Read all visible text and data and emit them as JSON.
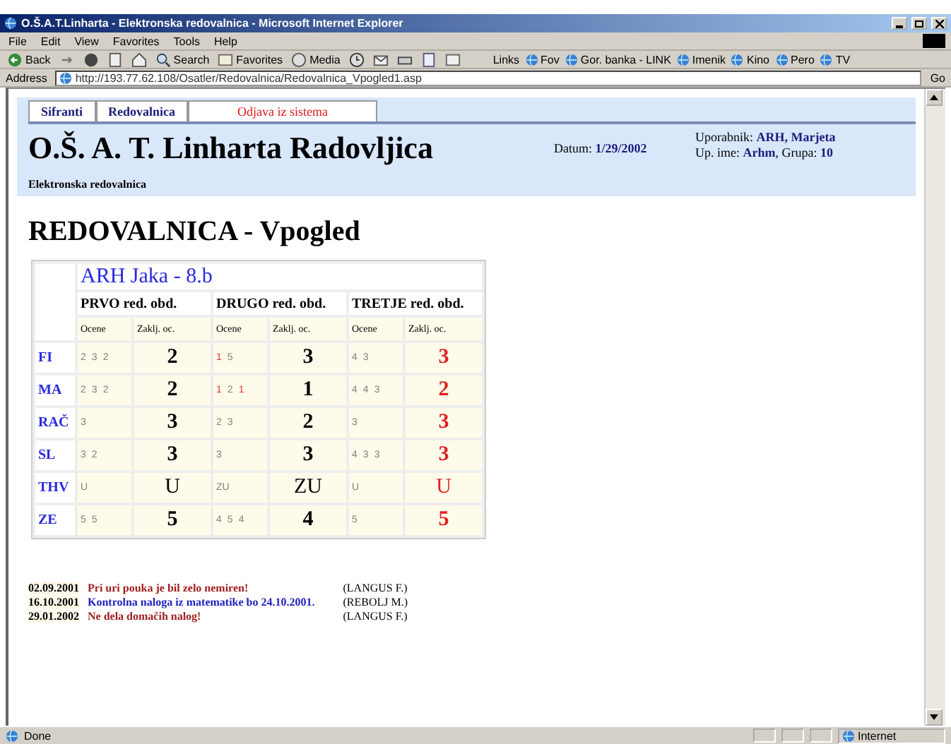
{
  "window": {
    "title": "O.Š.A.T.Linharta - Elektronska redovalnica - Microsoft Internet Explorer"
  },
  "menu": [
    "File",
    "Edit",
    "View",
    "Favorites",
    "Tools",
    "Help"
  ],
  "toolbar": [
    {
      "kind": "back",
      "label": "Back"
    },
    {
      "kind": "forward"
    },
    {
      "kind": "stop"
    },
    {
      "kind": "refresh"
    },
    {
      "kind": "home"
    },
    {
      "kind": "search",
      "label": "Search"
    },
    {
      "kind": "favorites",
      "label": "Favorites"
    },
    {
      "kind": "media",
      "label": "Media"
    },
    {
      "kind": "history"
    },
    {
      "kind": "mail"
    },
    {
      "kind": "print"
    },
    {
      "kind": "edit"
    },
    {
      "kind": "discuss"
    }
  ],
  "links": {
    "label": "Links",
    "items": [
      "Fov",
      "Gor. banka - LINK",
      "Imenik",
      "Kino",
      "Pero",
      "TV"
    ]
  },
  "address": {
    "label": "Address",
    "value": "http://193.77.62.108/Osatler/Redovalnica/Redovalnica_Vpogled1.asp",
    "go": "Go"
  },
  "nav_tabs": [
    {
      "label": "Sifranti",
      "kind": "normal"
    },
    {
      "label": "Redovalnica",
      "kind": "normal"
    },
    {
      "label": "Odjava iz sistema",
      "kind": "logout"
    }
  ],
  "header": {
    "school": "O.Š. A. T. Linharta Radovljica",
    "date": "Datum: **1/29/2002**",
    "user": "Uporabnik: **ARH, Marjeta**",
    "login": "Up. ime: **Arhm**, Grupa: **10**",
    "subtitle": "Elektronska redovalnica"
  },
  "page_title": "REDOVALNICA - Vpogled",
  "grades": {
    "student": "ARH Jaka - 8.b",
    "periods": [
      "PRVO red. obd.",
      "DRUGO red. obd.",
      "TRETJE red. obd."
    ],
    "subheads": [
      "Ocene",
      "Zaklj. oc.",
      "Ocene",
      "Zaklj. oc.",
      "Ocene",
      "Zaklj. oc."
    ],
    "rows": [
      {
        "subject": "FI",
        "periods": [
          {
            "marks": [
              {
                "text": "2",
                "color": "#808080"
              },
              {
                "text": "3",
                "color": "#808080"
              },
              {
                "text": "2",
                "color": "#808080"
              }
            ],
            "final": {
              "text": "2",
              "color": "#000000"
            }
          },
          {
            "marks": [
              {
                "text": "1",
                "color": "#e03030"
              },
              {
                "text": "5",
                "color": "#808080"
              }
            ],
            "final": {
              "text": "3",
              "color": "#000000"
            }
          },
          {
            "marks": [
              {
                "text": "4",
                "color": "#808080"
              },
              {
                "text": "3",
                "color": "#808080"
              }
            ],
            "final": {
              "text": "3",
              "color": "#e02020"
            }
          }
        ]
      },
      {
        "subject": "MA",
        "periods": [
          {
            "marks": [
              {
                "text": "2",
                "color": "#808080"
              },
              {
                "text": "3",
                "color": "#808080"
              },
              {
                "text": "2",
                "color": "#808080"
              }
            ],
            "final": {
              "text": "2",
              "color": "#000000"
            }
          },
          {
            "marks": [
              {
                "text": "1",
                "color": "#e03030"
              },
              {
                "text": "2",
                "color": "#808080"
              },
              {
                "text": "1",
                "color": "#e03030"
              }
            ],
            "final": {
              "text": "1",
              "color": "#000000"
            }
          },
          {
            "marks": [
              {
                "text": "4",
                "color": "#808080"
              },
              {
                "text": "4",
                "color": "#808080"
              },
              {
                "text": "3",
                "color": "#808080"
              }
            ],
            "final": {
              "text": "2",
              "color": "#e02020"
            }
          }
        ]
      },
      {
        "subject": "RAČ",
        "periods": [
          {
            "marks": [
              {
                "text": "3",
                "color": "#808080"
              }
            ],
            "final": {
              "text": "3",
              "color": "#000000"
            }
          },
          {
            "marks": [
              {
                "text": "2",
                "color": "#808080"
              },
              {
                "text": "3",
                "color": "#808080"
              }
            ],
            "final": {
              "text": "2",
              "color": "#000000"
            }
          },
          {
            "marks": [
              {
                "text": "3",
                "color": "#808080"
              }
            ],
            "final": {
              "text": "3",
              "color": "#e02020"
            }
          }
        ]
      },
      {
        "subject": "SL",
        "periods": [
          {
            "marks": [
              {
                "text": "3",
                "color": "#808080"
              },
              {
                "text": "2",
                "color": "#808080"
              }
            ],
            "final": {
              "text": "3",
              "color": "#000000"
            }
          },
          {
            "marks": [
              {
                "text": "3",
                "color": "#808080"
              }
            ],
            "final": {
              "text": "3",
              "color": "#000000"
            }
          },
          {
            "marks": [
              {
                "text": "4",
                "color": "#808080"
              },
              {
                "text": "3",
                "color": "#808080"
              },
              {
                "text": "3",
                "color": "#808080"
              }
            ],
            "final": {
              "text": "3",
              "color": "#e02020"
            }
          }
        ]
      },
      {
        "subject": "THV",
        "periods": [
          {
            "marks": [
              {
                "text": "U",
                "color": "#808080"
              }
            ],
            "final": {
              "text": "U",
              "color": "#000000"
            }
          },
          {
            "marks": [
              {
                "text": "ZU",
                "color": "#808080"
              }
            ],
            "final": {
              "text": "ZU",
              "color": "#000000"
            }
          },
          {
            "marks": [
              {
                "text": "U",
                "color": "#808080"
              }
            ],
            "final": {
              "text": "U",
              "color": "#e02020"
            }
          }
        ]
      },
      {
        "subject": "ZE",
        "periods": [
          {
            "marks": [
              {
                "text": "5",
                "color": "#808080"
              },
              {
                "text": "5",
                "color": "#808080"
              }
            ],
            "final": {
              "text": "5",
              "color": "#000000"
            }
          },
          {
            "marks": [
              {
                "text": "4",
                "color": "#808080"
              },
              {
                "text": "5",
                "color": "#808080"
              },
              {
                "text": "4",
                "color": "#808080"
              }
            ],
            "final": {
              "text": "4",
              "color": "#000000"
            }
          },
          {
            "marks": [
              {
                "text": "5",
                "color": "#808080"
              }
            ],
            "final": {
              "text": "5",
              "color": "#e02020"
            }
          }
        ]
      }
    ]
  },
  "notes": [
    {
      "date": "02.09.2001",
      "text": "Pri uri pouka je bil zelo nemiren!",
      "color": "#a02020",
      "teacher": "(LANGUS F.)"
    },
    {
      "date": "16.10.2001",
      "text": "Kontrolna naloga iz matematike bo 24.10.2001.",
      "color": "#2020c0",
      "teacher": "(REBOLJ M.)"
    },
    {
      "date": "29.01.2002",
      "text": "Ne dela domačih nalog!",
      "color": "#a02020",
      "teacher": "(LANGUS F.)"
    }
  ],
  "status_bar": {
    "text": "Done",
    "zone": "Internet"
  }
}
